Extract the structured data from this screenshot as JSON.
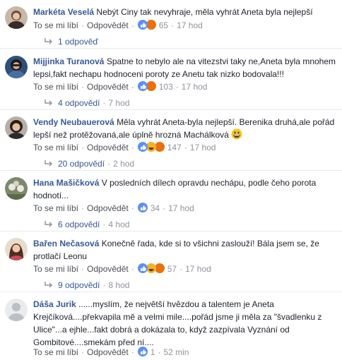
{
  "ui": {
    "like": "To se mi líbí",
    "reply": "Odpovědět",
    "sep": "·"
  },
  "comments": [
    {
      "author": "Markéta Veselá",
      "text": "Nebýt Ciny tak nevyhraje, měla vyhrát Aneta byla nejlepší",
      "reactions": "65",
      "time": "17 hod",
      "replies_label": "1 odpověď",
      "replies_time": ""
    },
    {
      "author": "Mijjinka Turanová",
      "text": "Spatne to nebylo ale na vitezstvi taky ne,Aneta byla mnohem lepsi,fakt nechapu hodnoceni poroty ze Anetu tak nizko bodovala!!!",
      "reactions": "103",
      "time": "17 hod",
      "replies_label": "4 odpovědí",
      "replies_time": "7 hod"
    },
    {
      "author": "Vendy Neubauerová",
      "text": "Měla vyhrát Aneta-byla nejlepší. Berenika druhá,ale pořád lepší než protěžovaná,ale úplně hrozná Machálková",
      "reactions": "147",
      "time": "17 hod",
      "replies_label": "20 odpovědí",
      "replies_time": "2 hod"
    },
    {
      "author": "Hana Mašičková",
      "text": "V posledních dílech opravdu nechápu, podle čeho porota hodnotí...",
      "reactions": "34",
      "time": "17 hod",
      "replies_label": "6 odpovědí",
      "replies_time": "4 hod"
    },
    {
      "author": "Bařen Nečasová",
      "text": "Konečně řada, kde si to všichni zaslouží! Bála jsem se, že protlačí Leonu",
      "reactions": "57",
      "time": "17 hod",
      "replies_label": "9 odpovědí",
      "replies_time": "8 hod"
    },
    {
      "author": "Dáša Jurik",
      "text": "......myslím, že největší hvězdou a talentem je Aneta Krejčíková....překvapila mě a velmi mile....pořád jsme ji měla za \"švadlenku z Ulice\"...a ejhle...fakt dobrá a dokázala to, když zazpívala Vyznání od Gombitové....smekám před ní....",
      "reactions": "1",
      "time": "52 min",
      "replies_label": "",
      "replies_time": ""
    }
  ],
  "colors": {
    "author": "#365899",
    "meta": "#90949c",
    "like": "#5890ff",
    "haha": "#f7b125",
    "angry": "#e9710f"
  },
  "icons": [
    "like-icon",
    "haha-icon",
    "angry-icon",
    "reply-arrow-icon",
    "grinning-emoji-icon"
  ]
}
